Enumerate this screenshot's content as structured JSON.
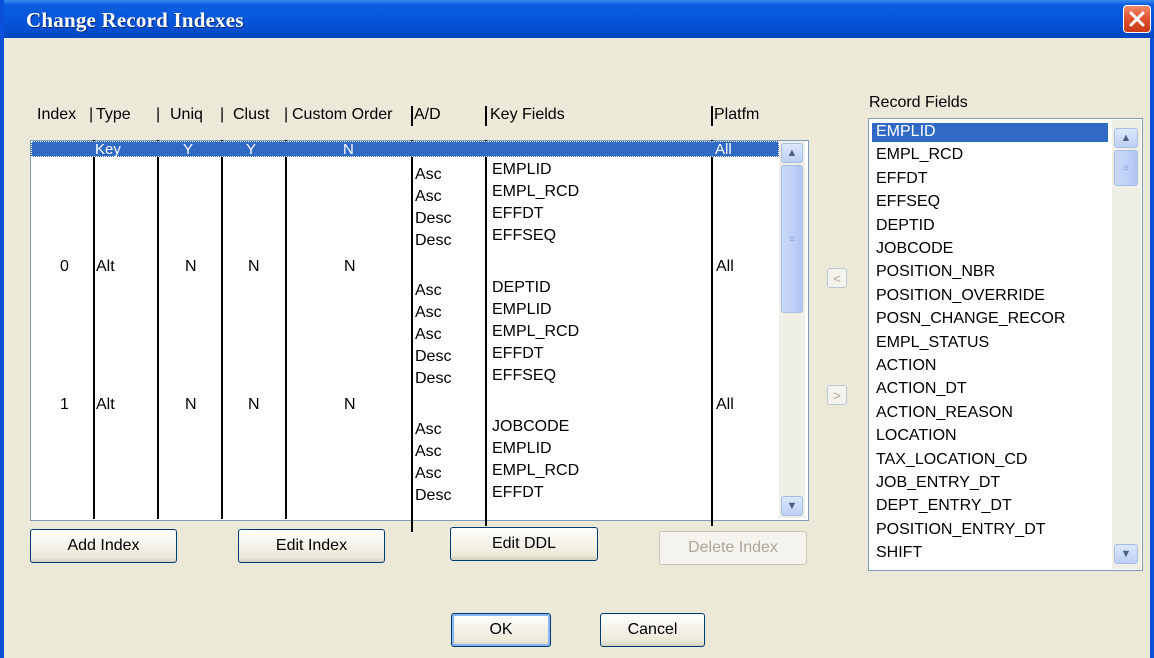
{
  "window": {
    "title": "Change Record Indexes"
  },
  "grid": {
    "headers": [
      "Index",
      "Type",
      "Uniq",
      "Clust",
      "Custom Order",
      "A/D",
      "Key Fields",
      "Platfm"
    ],
    "header_separators": [
      "|",
      "|",
      "|",
      "|"
    ],
    "selected_row": {
      "type": "Key",
      "uniq": "Y",
      "clust": "Y",
      "custom_order": "N",
      "platform": "All"
    },
    "indexes": [
      {
        "index": "0",
        "type": "Alt",
        "uniq": "N",
        "clust": "N",
        "custom_order": "N",
        "platform": "All",
        "keys": [
          [
            "Asc",
            "EMPLID"
          ],
          [
            "Asc",
            "EMPL_RCD"
          ],
          [
            "Desc",
            "EFFDT"
          ],
          [
            "Desc",
            "EFFSEQ"
          ]
        ]
      },
      {
        "index": "1",
        "type": "Alt",
        "uniq": "N",
        "clust": "N",
        "custom_order": "N",
        "platform": "All",
        "keys": [
          [
            "Asc",
            "DEPTID"
          ],
          [
            "Asc",
            "EMPLID"
          ],
          [
            "Asc",
            "EMPL_RCD"
          ],
          [
            "Desc",
            "EFFDT"
          ],
          [
            "Desc",
            "EFFSEQ"
          ]
        ]
      },
      {
        "keys": [
          [
            "Asc",
            "JOBCODE"
          ],
          [
            "Asc",
            "EMPLID"
          ],
          [
            "Asc",
            "EMPL_RCD"
          ],
          [
            "Desc",
            "EFFDT"
          ]
        ]
      }
    ]
  },
  "buttons": {
    "add_index": "Add Index",
    "edit_index": "Edit Index",
    "edit_ddl": "Edit DDL",
    "delete_index": "Delete Index",
    "ok": "OK",
    "cancel": "Cancel"
  },
  "record_fields": {
    "label": "Record Fields",
    "items": [
      "EMPLID",
      "EMPL_RCD",
      "EFFDT",
      "EFFSEQ",
      "DEPTID",
      "JOBCODE",
      "POSITION_NBR",
      "POSITION_OVERRIDE",
      "POSN_CHANGE_RECOR",
      "EMPL_STATUS",
      "ACTION",
      "ACTION_DT",
      "ACTION_REASON",
      "LOCATION",
      "TAX_LOCATION_CD",
      "JOB_ENTRY_DT",
      "DEPT_ENTRY_DT",
      "POSITION_ENTRY_DT",
      "SHIFT"
    ],
    "selected": "EMPLID"
  },
  "icons": {
    "close": "close-icon",
    "add_field": "arrow-left-icon",
    "remove_field": "arrow-right-icon"
  },
  "colors": {
    "selection": "#316ac5",
    "titlebar": "#0754d8"
  }
}
